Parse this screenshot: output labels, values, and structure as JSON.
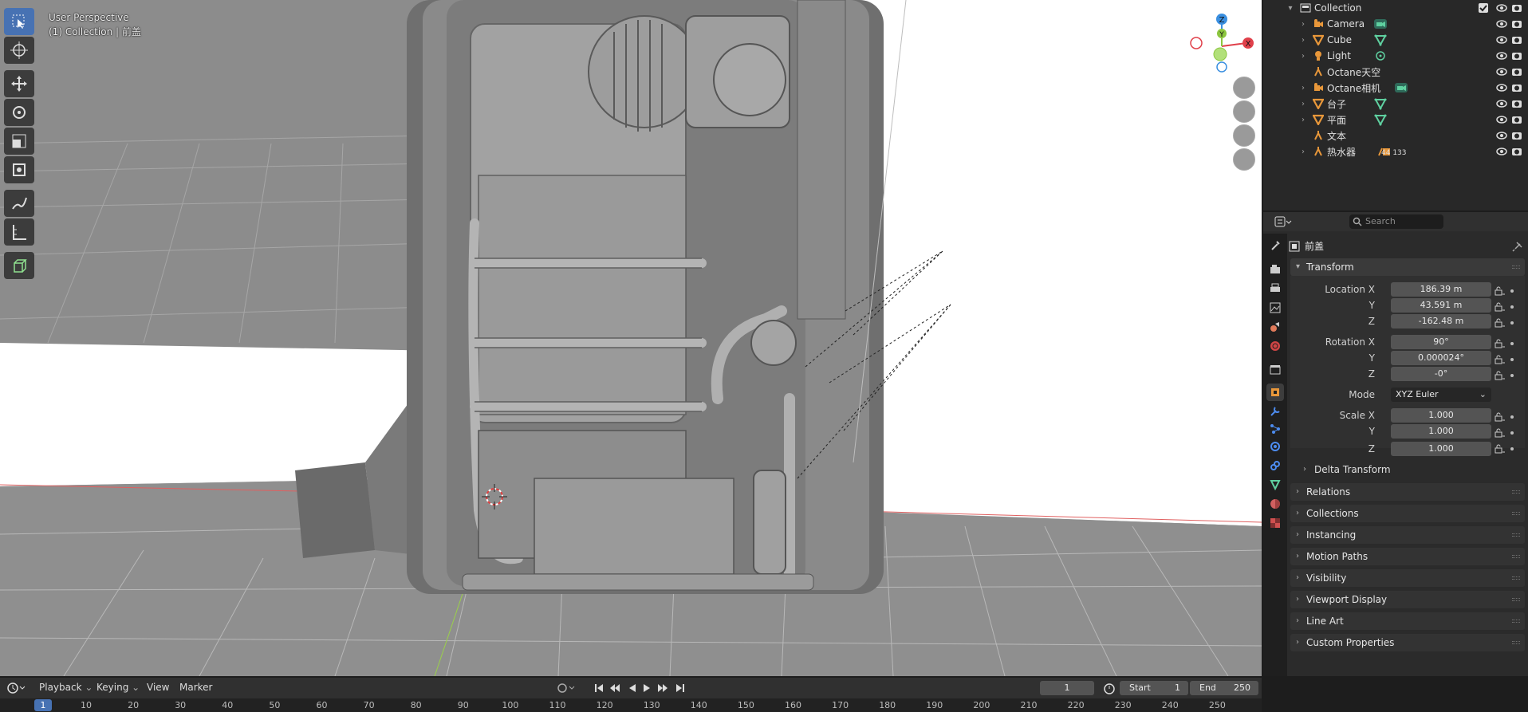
{
  "viewport": {
    "perspective_label": "User Perspective",
    "context_label": "(1) Collection | 前盖",
    "gizmo": {
      "z": "Z",
      "y": "Y",
      "x": "X"
    },
    "tools": [
      "select-box",
      "cursor",
      "move",
      "rotate",
      "scale",
      "transform",
      "annotate",
      "measure",
      "add-cube"
    ]
  },
  "outliner": {
    "collection": "Collection",
    "items": [
      {
        "label": "Camera",
        "icon": "camera-object-icon",
        "data_icon": "camera-data-icon",
        "expandable": true
      },
      {
        "label": "Cube",
        "icon": "mesh-object-icon",
        "data_icon": "mesh-data-icon",
        "expandable": true
      },
      {
        "label": "Light",
        "icon": "light-object-icon",
        "data_icon": "light-data-icon",
        "expandable": true
      },
      {
        "label": "Octane天空",
        "icon": "empty-object-icon",
        "data_icon": "",
        "expandable": false
      },
      {
        "label": "Octane相机",
        "icon": "camera-object-icon",
        "data_icon": "camera-data-icon",
        "expandable": true
      },
      {
        "label": "台子",
        "icon": "mesh-object-icon",
        "data_icon": "mesh-data-icon",
        "expandable": true
      },
      {
        "label": "平面",
        "icon": "mesh-object-icon",
        "data_icon": "mesh-data-icon",
        "expandable": true
      },
      {
        "label": "文本",
        "icon": "empty-object-icon",
        "data_icon": "",
        "expandable": false
      },
      {
        "label": "热水器",
        "icon": "empty-object-icon",
        "data_icon": "children-icon",
        "expandable": true,
        "badge": "44 133"
      }
    ]
  },
  "properties": {
    "search_placeholder": "Search",
    "object_name": "前盖",
    "object_field": "前盖",
    "transform": {
      "title": "Transform",
      "location_label": "Location X",
      "location": [
        "186.39 m",
        "43.591 m",
        "-162.48 m"
      ],
      "rotation_label": "Rotation X",
      "rotation": [
        "90°",
        "0.000024°",
        "-0°"
      ],
      "mode_label": "Mode",
      "mode_value": "XYZ Euler",
      "scale_label": "Scale X",
      "scale": [
        "1.000",
        "1.000",
        "1.000"
      ],
      "y_label": "Y",
      "z_label": "Z",
      "delta": "Delta Transform"
    },
    "panels": [
      "Relations",
      "Collections",
      "Instancing",
      "Motion Paths",
      "Visibility",
      "Viewport Display",
      "Line Art",
      "Custom Properties"
    ]
  },
  "timeline": {
    "menus": [
      "Playback",
      "Keying",
      "View",
      "Marker"
    ],
    "current_frame": "1",
    "start_label": "Start",
    "start_value": "1",
    "end_label": "End",
    "end_value": "250",
    "ruler_current": "1",
    "ticks": [
      "10",
      "20",
      "30",
      "40",
      "50",
      "60",
      "70",
      "80",
      "90",
      "100",
      "110",
      "120",
      "130",
      "140",
      "150",
      "160",
      "170",
      "180",
      "190",
      "200",
      "210",
      "220",
      "230",
      "240",
      "250"
    ]
  },
  "colors": {
    "accent": "#4772b3",
    "axis_x": "#e0404a",
    "axis_y": "#8cc63f",
    "axis_z": "#3a8fe0",
    "object_orange": "#e8973a",
    "data_green": "#5fd0a0"
  }
}
